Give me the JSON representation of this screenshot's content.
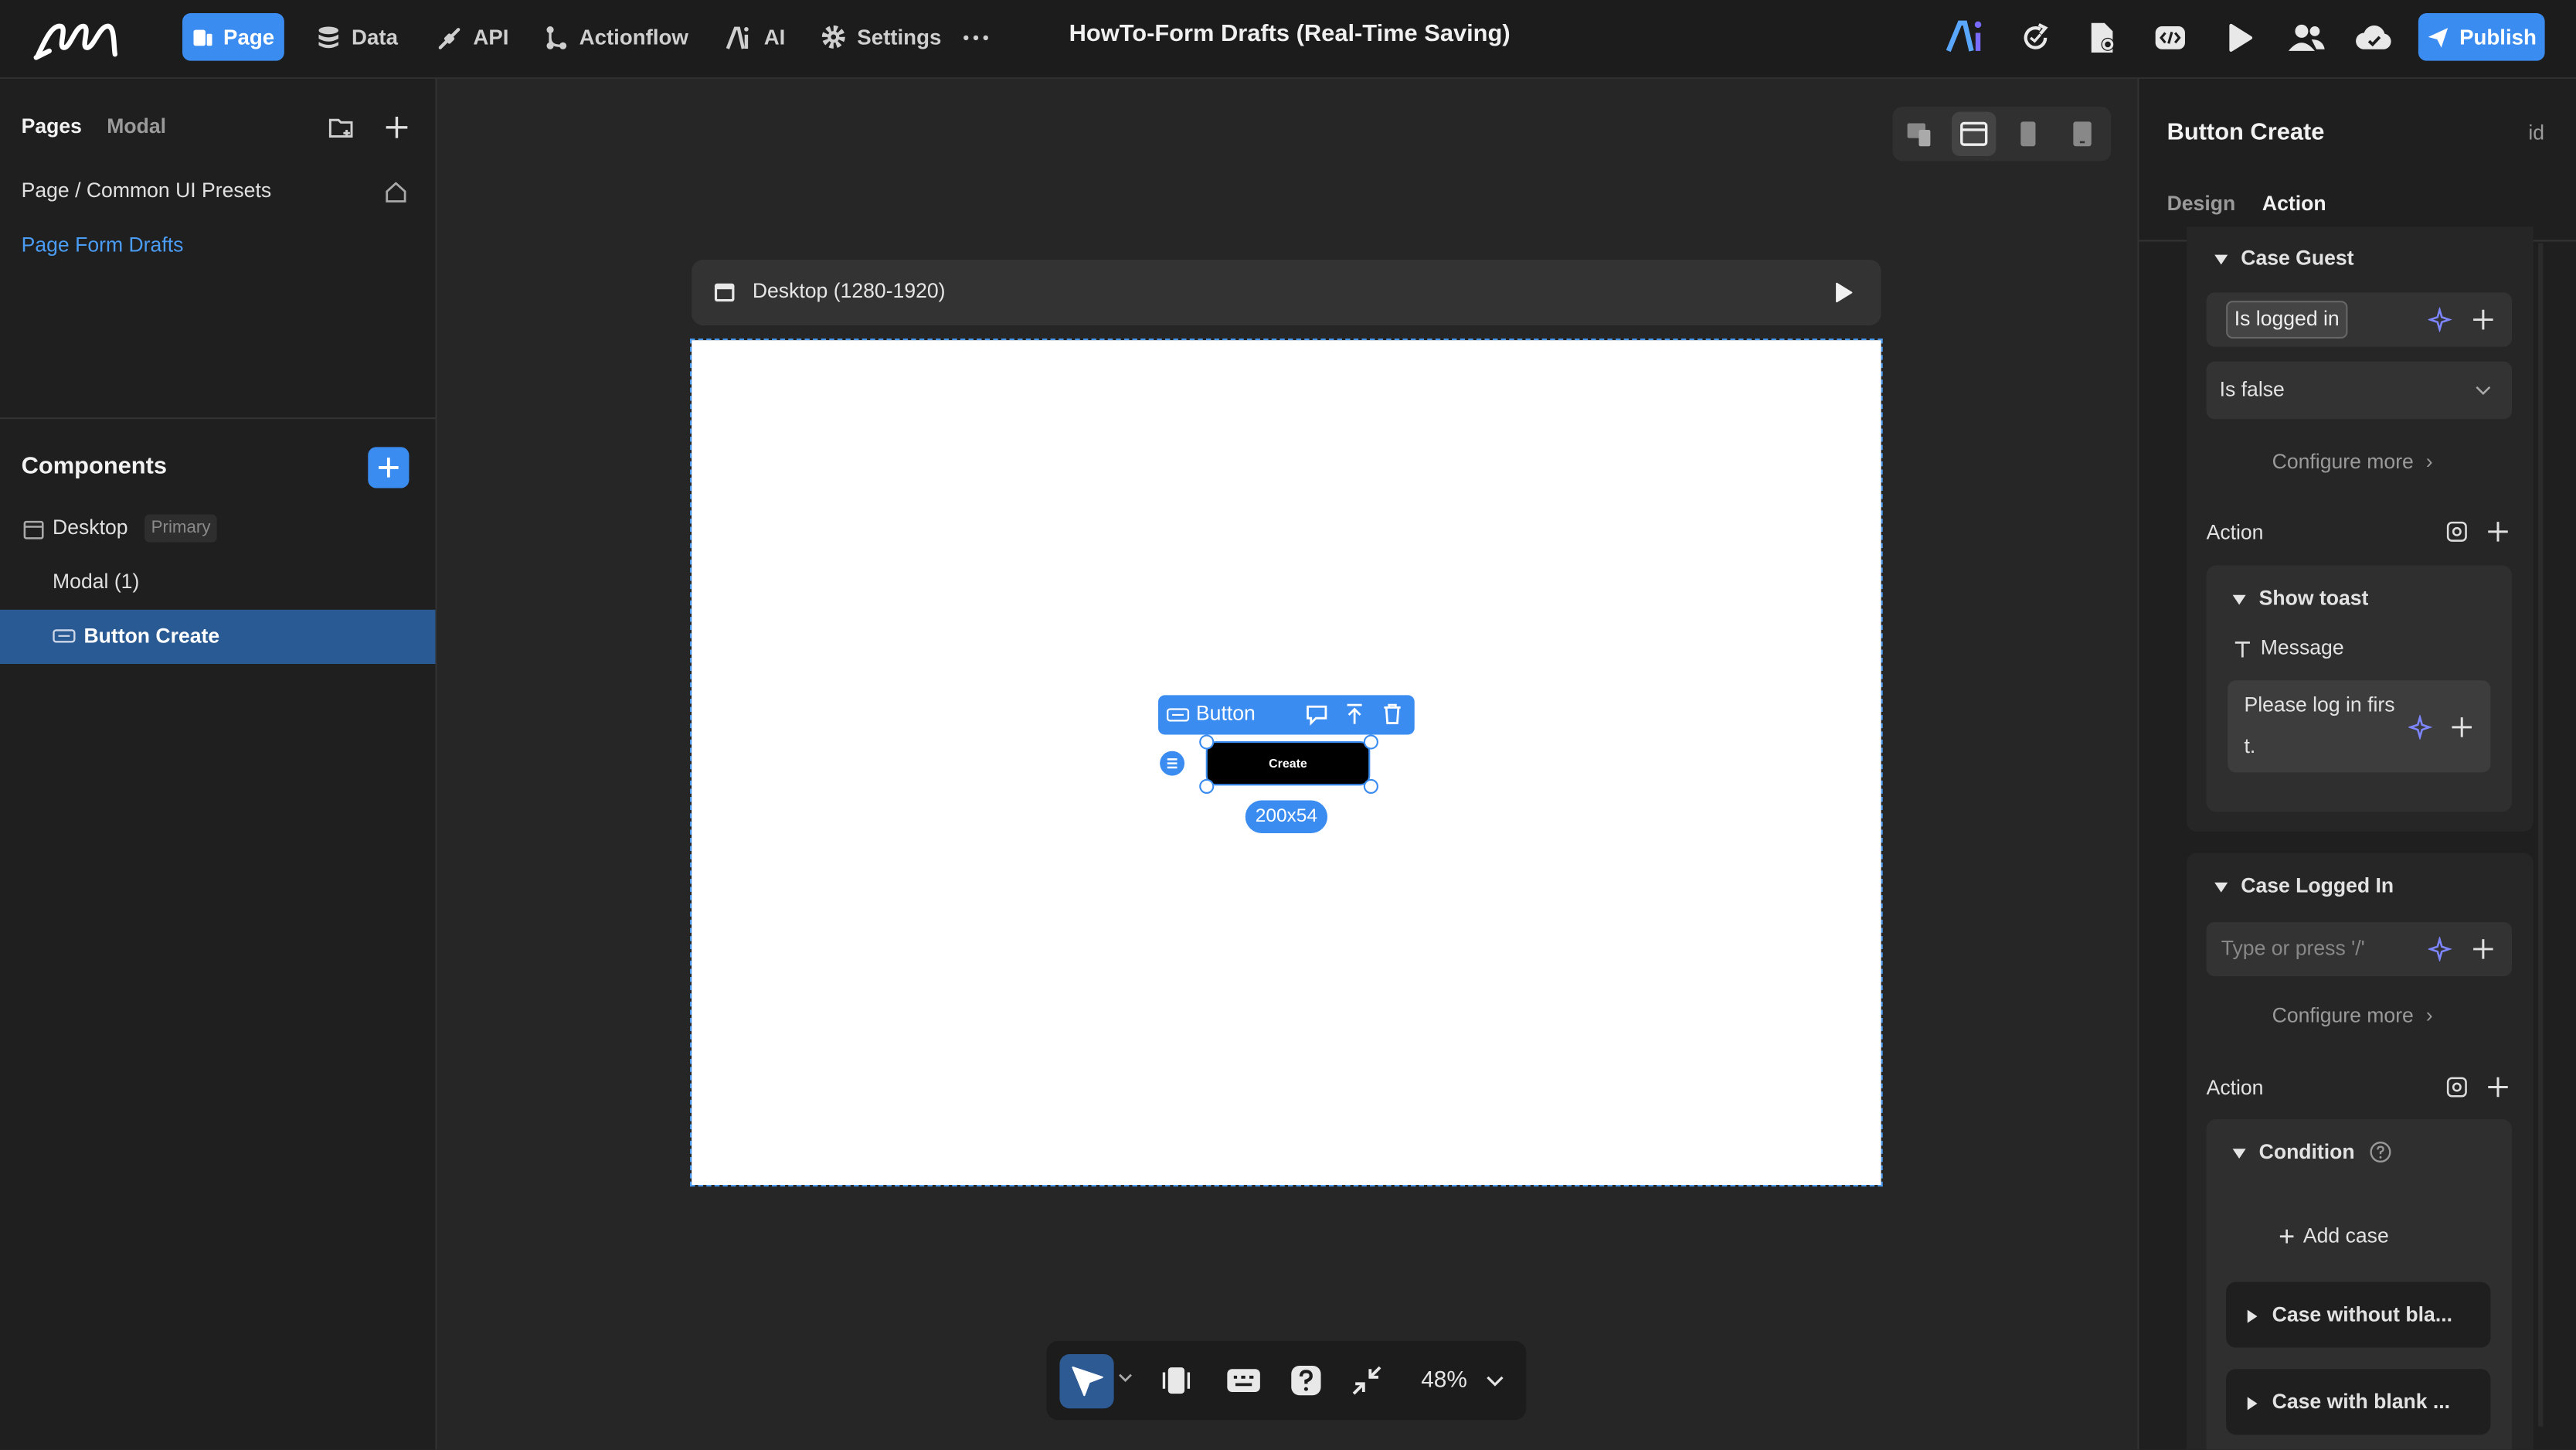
{
  "topbar": {
    "nav": [
      {
        "label": "Page",
        "icon": "page-icon",
        "active": true
      },
      {
        "label": "Data",
        "icon": "database-icon"
      },
      {
        "label": "API",
        "icon": "api-icon"
      },
      {
        "label": "Actionflow",
        "icon": "actionflow-icon"
      },
      {
        "label": "AI",
        "icon": "ai-icon"
      },
      {
        "label": "Settings",
        "icon": "gear-icon"
      }
    ],
    "title": "HowTo-Form Drafts (Real-Time Saving)",
    "publish_label": "Publish",
    "accent": "#3b8cf0"
  },
  "left": {
    "tab_pages": "Pages",
    "tab_modal": "Modal",
    "pages": [
      {
        "label": "Page / Common UI Presets"
      },
      {
        "label": "Page Form Drafts"
      }
    ],
    "components_title": "Components",
    "tree": [
      {
        "label": "Desktop",
        "badge": "Primary"
      },
      {
        "label": "Modal (1)"
      },
      {
        "label": "Button Create"
      }
    ]
  },
  "canvas": {
    "frame_label": "Desktop (1280-1920)",
    "toolbar_label": "Button",
    "button_text": "Create",
    "size_badge": "200x54",
    "zoom": "48%"
  },
  "right": {
    "title": "Button Create",
    "id_label": "id",
    "tab_design": "Design",
    "tab_action": "Action",
    "case_guest": {
      "title": "Case Guest",
      "condition_tag": "Is logged in",
      "select_value": "Is false",
      "configure_more": "Configure more",
      "action_label": "Action",
      "toast_title": "Show toast",
      "message_label": "Message",
      "message_line1": "Please log in firs",
      "message_line2": "t."
    },
    "case_logged_in": {
      "title": "Case Logged In",
      "placeholder": "Type or press '/'",
      "configure_more": "Configure more",
      "action_label": "Action",
      "condition_title": "Condition",
      "add_case": "Add case",
      "sub_cases": [
        "Case without bla...",
        "Case with blank ..."
      ]
    }
  }
}
